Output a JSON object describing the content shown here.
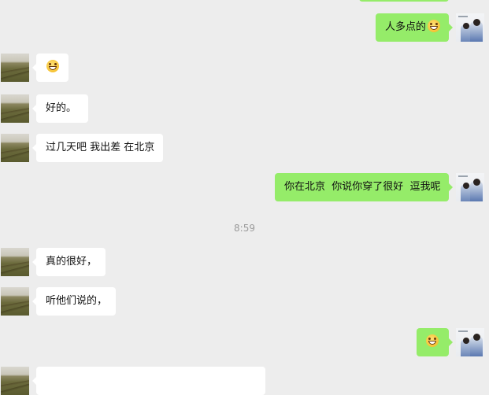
{
  "messages": [
    {
      "side": "out",
      "text": "人多点的",
      "emoji": "grin-emoji"
    },
    {
      "side": "in",
      "text": "",
      "emoji": "grin-emoji"
    },
    {
      "side": "in",
      "text": "好的。"
    },
    {
      "side": "in",
      "text": "过几天吧 我出差 在北京"
    },
    {
      "side": "out",
      "text": "你在北京  你说你穿了很好  逗我呢"
    },
    {
      "side": "in",
      "text": "真的很好，"
    },
    {
      "side": "in",
      "text": "听他们说的，"
    },
    {
      "side": "out",
      "text": "",
      "emoji": "grin-emoji"
    }
  ],
  "timestamp": "8:59",
  "colors": {
    "background": "#ededed",
    "incoming_bubble": "#ffffff",
    "outgoing_bubble": "#95ec69",
    "timestamp_text": "#9b9b9b"
  }
}
